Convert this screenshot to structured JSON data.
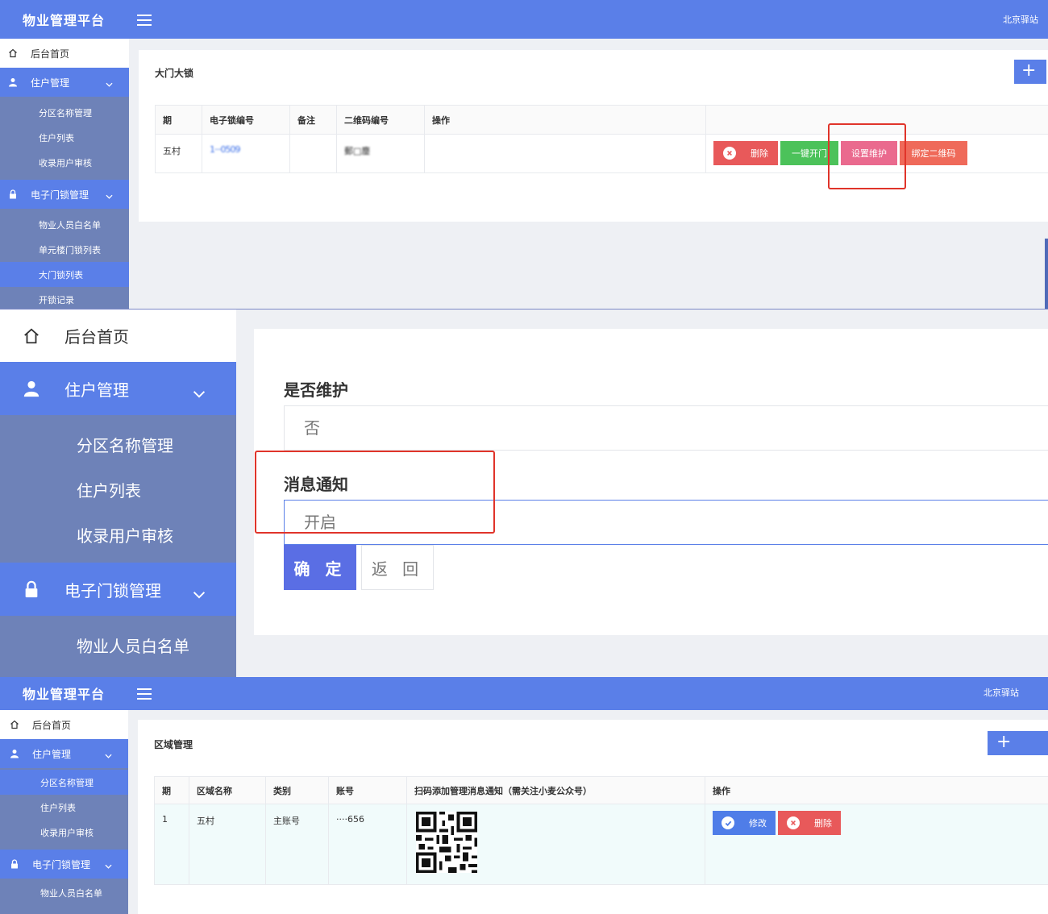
{
  "colors": {
    "primary": "#5a7fe8",
    "sidebar": "#6e82b8",
    "danger": "#e8595a",
    "success": "#4cc25a",
    "warning_pink": "#ea6a8e",
    "highlight_box": "#e0342a"
  },
  "header": {
    "brand": "物业管理平台",
    "site": "北京驿站"
  },
  "sidebar": {
    "home": "后台首页",
    "resident_group": "住户管理",
    "resident_items": [
      "分区名称管理",
      "住户列表",
      "收录用户审核"
    ],
    "lock_group": "电子门锁管理",
    "lock_items": [
      "物业人员白名单",
      "单元楼门锁列表",
      "大门锁列表",
      "开锁记录"
    ]
  },
  "panel1": {
    "title": "大门大锁",
    "add_icon": "plus-icon",
    "columns": [
      "期",
      "电子锁编号",
      "备注",
      "二维码编号",
      "操作"
    ],
    "row": {
      "period": "五村",
      "lock_no": "1···0509",
      "note": "",
      "qr_no": "郵□鏖"
    },
    "actions": {
      "delete": "删除",
      "open": "一键开门",
      "maintain": "设置维护",
      "bind_qr": "绑定二维码"
    }
  },
  "panel2": {
    "maintain_label": "是否维护",
    "maintain_value": "否",
    "notify_label": "消息通知",
    "notify_value": "开启",
    "confirm": "确 定",
    "back": "返 回"
  },
  "panel3": {
    "title": "区域管理",
    "add_icon": "plus-icon",
    "columns": [
      "期",
      "区域名称",
      "类别",
      "账号",
      "扫码添加管理消息通知（需关注小麦公众号）",
      "操作"
    ],
    "row": {
      "period": "1",
      "area_name": "五村",
      "category": "主账号",
      "account": "····656"
    },
    "actions": {
      "edit": "修改",
      "delete": "删除"
    }
  }
}
